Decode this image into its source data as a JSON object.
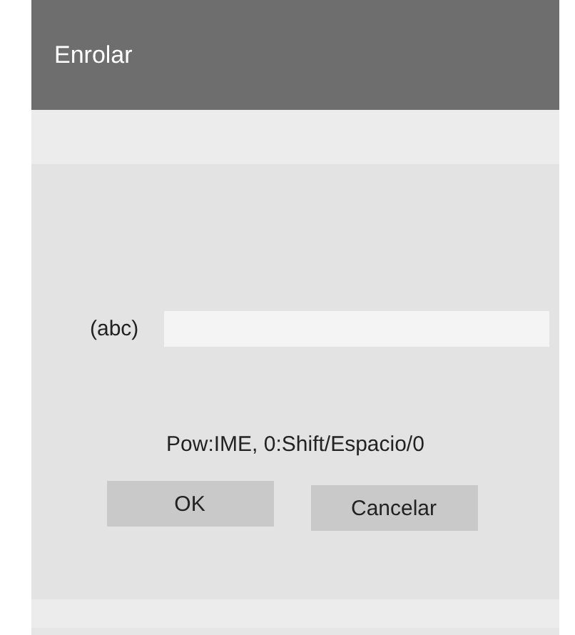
{
  "window": {
    "title": "Enrolar"
  },
  "field": {
    "label": "(abc)"
  },
  "hint": "Pow:IME, 0:Shift/Espacio/0",
  "buttons": [
    {
      "label": "OK"
    },
    {
      "label": "Cancelar"
    }
  ]
}
